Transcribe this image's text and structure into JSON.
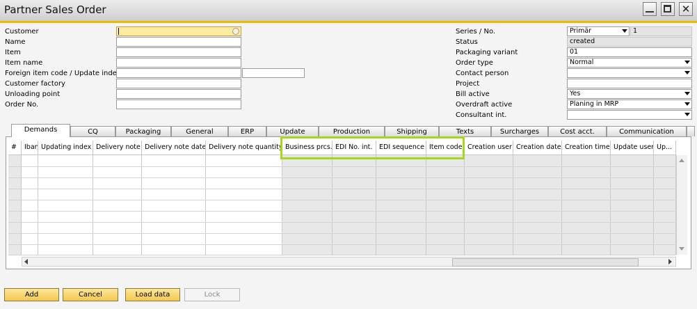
{
  "window": {
    "title": "Partner Sales Order"
  },
  "header_left": [
    {
      "label": "Customer",
      "value": ""
    },
    {
      "label": "Name",
      "value": ""
    },
    {
      "label": "Item",
      "value": ""
    },
    {
      "label": "Item name",
      "value": ""
    },
    {
      "label": "Foreign item code / Update index",
      "value": ""
    },
    {
      "label": "Customer factory",
      "value": ""
    },
    {
      "label": "Unloading point",
      "value": ""
    },
    {
      "label": "Order No.",
      "value": ""
    }
  ],
  "header_right": [
    {
      "label": "Series / No.",
      "value": "Primär",
      "value2": "1"
    },
    {
      "label": "Status",
      "value": "created"
    },
    {
      "label": "Packaging variant",
      "value": "01"
    },
    {
      "label": "Order type",
      "value": "Normal"
    },
    {
      "label": "Contact person",
      "value": ""
    },
    {
      "label": "Project",
      "value": ""
    },
    {
      "label": "Bill active",
      "value": "Yes"
    },
    {
      "label": "Overdraft active",
      "value": "Planing in MRP"
    },
    {
      "label": "Consultant int.",
      "value": ""
    }
  ],
  "tabs": [
    "Demands",
    "CQ",
    "Packaging",
    "General",
    "ERP",
    "Update",
    "Production",
    "Shipping",
    "Texts",
    "Surcharges",
    "Cost acct.",
    "Communication"
  ],
  "grid": {
    "columns": [
      "#",
      "Iban",
      "Updating index",
      "Delivery note",
      "Delivery note date",
      "Delivery note quantity",
      "Business prcs.",
      "EDI No. int.",
      "EDI sequence",
      "Item code",
      "Creation user",
      "Creation date",
      "Creation time",
      "Update user",
      "Up..."
    ]
  },
  "buttons": {
    "add": "Add",
    "cancel": "Cancel",
    "load": "Load data",
    "lock": "Lock"
  },
  "colors": {
    "accent": "#f1b800",
    "highlight": "#a6d71f",
    "button": "#f2c850"
  }
}
